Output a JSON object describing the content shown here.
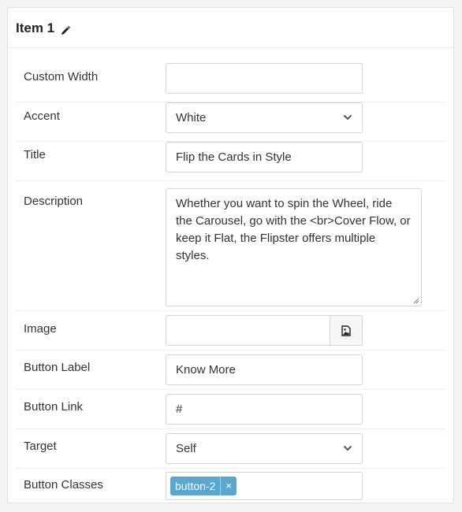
{
  "item": {
    "title": "Item 1"
  },
  "fields": {
    "custom_width": {
      "label": "Custom Width",
      "value": ""
    },
    "accent": {
      "label": "Accent",
      "value": "White"
    },
    "title": {
      "label": "Title",
      "value": "Flip the Cards in Style"
    },
    "description": {
      "label": "Description",
      "value": "Whether you want to spin the Wheel, ride the Carousel, go with the <br>Cover Flow, or keep it Flat, the Flipster offers multiple styles."
    },
    "image": {
      "label": "Image",
      "value": ""
    },
    "button_label": {
      "label": "Button Label",
      "value": "Know More"
    },
    "button_link": {
      "label": "Button Link",
      "value": "#"
    },
    "target": {
      "label": "Target",
      "value": "Self"
    },
    "button_classes": {
      "label": "Button Classes",
      "tags": [
        "button-2"
      ],
      "remove_glyph": "×"
    }
  },
  "icons": {
    "edit": "pencil-icon",
    "select_arrow": "chevron-down-icon",
    "image_picker": "image-icon",
    "resize": "resize-handle-icon"
  },
  "colors": {
    "tag_bg": "#5aa7cf",
    "border": "#d4d4d4",
    "text": "#333333"
  }
}
